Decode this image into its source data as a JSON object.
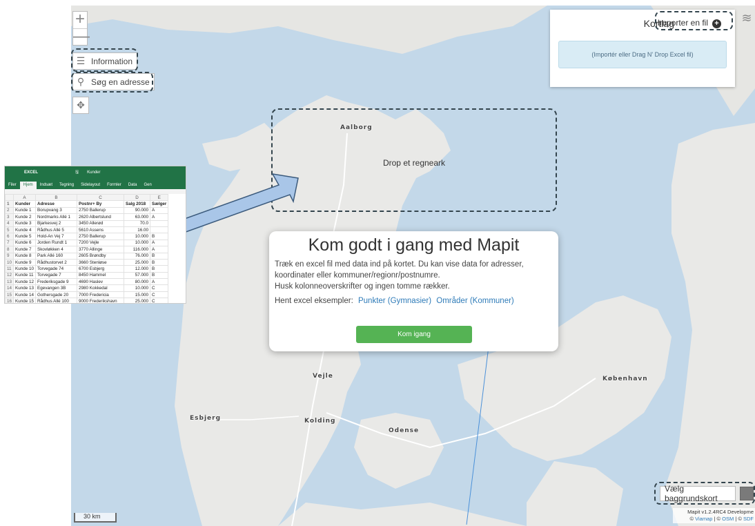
{
  "zoom": {
    "in_label": "+",
    "out_label": "—"
  },
  "controls": {
    "information_label": "Information",
    "search_label": "Søg en adresse"
  },
  "cities": [
    "Aalborg",
    "Vejle",
    "Kolding",
    "Esbjerg",
    "Odense",
    "København"
  ],
  "kortlag": {
    "title": "Kortlag",
    "import_label": "Importer en fil",
    "drop_hint": "(Importér eller Drag N' Drop Excel fil)"
  },
  "dropzone": {
    "label": "Drop et regneark"
  },
  "modal": {
    "title": "Kom godt i gang med Mapit",
    "text_line1": "Træk en excel fil med data ind på kortet. Du kan vise data for adresser,",
    "text_line2": "koordinater eller kommuner/regionr/postnumre.",
    "text_line3": "Husk kolonneoverskrifter og ingen tomme rækker.",
    "examples_label": "Hent excel eksempler:",
    "example_points": "Punkter (Gymnasier)",
    "example_areas": "Områder (Kommuner)",
    "button_label": "Kom igang"
  },
  "excel": {
    "app": "EXCEL",
    "file": "Kunder",
    "tabs": [
      "Filer",
      "Hjem",
      "Indsæt",
      "Tegning",
      "Sidelayout",
      "Formler",
      "Data",
      "Gen"
    ],
    "active_tab": "Hjem",
    "columns": [
      "A",
      "B",
      "C",
      "D",
      "E"
    ],
    "rows": [
      [
        "Kunder",
        "Adresse",
        "Postnr+ By",
        "Salg 2018",
        "Sælger"
      ],
      [
        "Kunde 1",
        "Borupvang 3",
        "2750 Ballerup",
        "90.000",
        "A"
      ],
      [
        "Kunde 2",
        "Nordmarks Allé 1",
        "2620 Albertslund",
        "63.000",
        "A"
      ],
      [
        "Kunde 3",
        "Bjarkesvej 2",
        "3450 Allerød",
        "70.0",
        ""
      ],
      [
        "Kunde 4",
        "Rådhus Allé 5",
        "5610 Assens",
        "16.00",
        ""
      ],
      [
        "Kunde 5",
        "Hold-An Vej 7",
        "2750 Ballerup",
        "10.000",
        "B"
      ],
      [
        "Kunde 6",
        "Jorden Rundt 1",
        "7200 Vejle",
        "10.000",
        "A"
      ],
      [
        "Kunde 7",
        "Skovløkken 4",
        "3770 Allinge",
        "116.000",
        "A"
      ],
      [
        "Kunde 8",
        "Park Allé 160",
        "2605 Brøndby",
        "76.000",
        "B"
      ],
      [
        "Kunde 9",
        "Rådhustorvet 2",
        "3660 Stenløse",
        "25.000",
        "B"
      ],
      [
        "Kunde 10",
        "Torvegade 74",
        "6700 Esbjerg",
        "12.000",
        "B"
      ],
      [
        "Kunde 11",
        "Torvegade 7",
        "8450 Hammel",
        "57.000",
        "B"
      ],
      [
        "Kunde 12",
        "Frederiksgade 9",
        "4690 Haslev",
        "80.000",
        "A"
      ],
      [
        "Kunde 13",
        "Egevangen 3B",
        "2980 Kokkedal",
        "10.000",
        "C"
      ],
      [
        "Kunde 14",
        "Gothersgade 20",
        "7000 Fredericia",
        "15.000",
        "C"
      ],
      [
        "Kunde 15",
        "Rådhus Allé 100",
        "9000 Frederikshavn",
        "25.000",
        "C"
      ]
    ]
  },
  "scale": {
    "label": "30 km"
  },
  "background_button": {
    "label": "Vælg baggrundskort"
  },
  "attribution": {
    "version": "Mapit v1.2.4RC4 Developme",
    "copy1": "©",
    "viamap": "Viamap",
    "osm": "OSM",
    "sdf": "SDF"
  },
  "colors": {
    "sea": "#c3d8e9",
    "land": "#e9e9e7",
    "accent": "#55b354",
    "dash": "#33444d"
  }
}
